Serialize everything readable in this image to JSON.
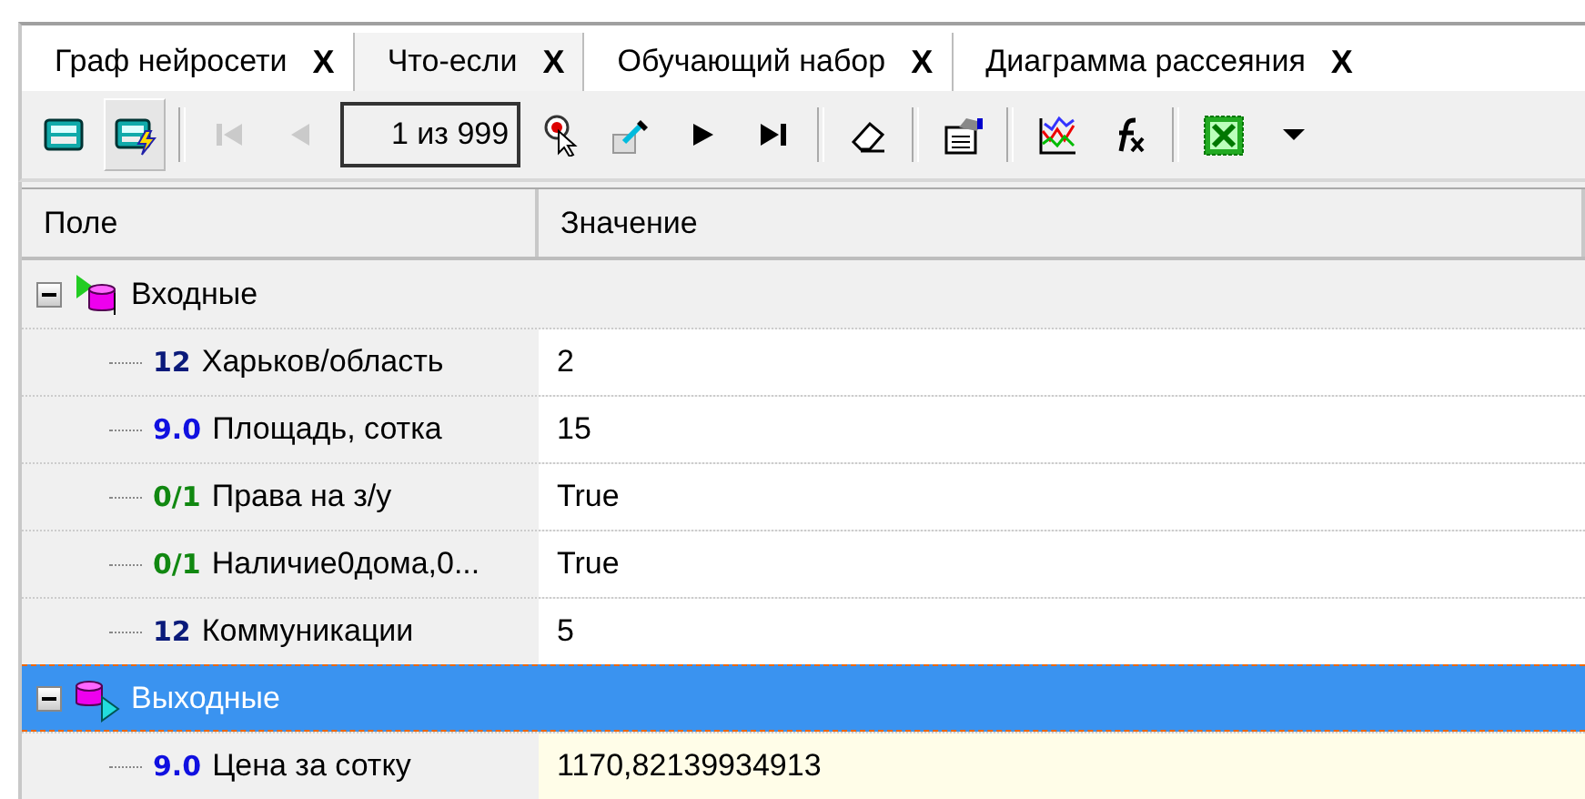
{
  "tabs": [
    {
      "label": "Граф нейросети",
      "close": "X",
      "selected": false
    },
    {
      "label": "Что-если",
      "close": "X",
      "selected": true
    },
    {
      "label": "Обучающий набор",
      "close": "X",
      "selected": false
    },
    {
      "label": "Диаграмма рассеяния",
      "close": "X",
      "selected": false
    }
  ],
  "toolbar": {
    "items": [
      {
        "kind": "button",
        "pressed": false,
        "disabled": false
      },
      {
        "kind": "button",
        "pressed": true,
        "disabled": false
      },
      {
        "kind": "separator"
      },
      {
        "kind": "button",
        "pressed": false,
        "disabled": true
      },
      {
        "kind": "button",
        "pressed": false,
        "disabled": true
      },
      {
        "kind": "record",
        "text": "1 из 999"
      },
      {
        "kind": "button",
        "pressed": false,
        "disabled": false
      },
      {
        "kind": "button",
        "pressed": false,
        "disabled": false
      },
      {
        "kind": "button",
        "pressed": false,
        "disabled": false
      },
      {
        "kind": "button",
        "pressed": false,
        "disabled": false
      },
      {
        "kind": "separator"
      },
      {
        "kind": "button",
        "pressed": false,
        "disabled": false
      },
      {
        "kind": "separator"
      },
      {
        "kind": "button",
        "pressed": false,
        "disabled": false
      },
      {
        "kind": "separator"
      },
      {
        "kind": "button",
        "pressed": false,
        "disabled": false
      },
      {
        "kind": "button",
        "pressed": false,
        "disabled": false
      },
      {
        "kind": "separator"
      },
      {
        "kind": "button",
        "pressed": false,
        "disabled": false
      },
      {
        "kind": "button",
        "pressed": false,
        "disabled": false
      }
    ]
  },
  "grid": {
    "columns": [
      "Поле",
      "Значение"
    ],
    "groups": [
      {
        "label": "Входные",
        "kind": "input",
        "expanded": true,
        "selected": false,
        "children": [
          {
            "type_label": "12",
            "kind": "integer",
            "name": "Харьков/область",
            "value": "2"
          },
          {
            "type_label": "9.0",
            "kind": "real",
            "name": "Площадь, сотка",
            "value": "15"
          },
          {
            "type_label": "0/1",
            "kind": "boolean",
            "name": "Права на з/у",
            "value": "True"
          },
          {
            "type_label": "0/1",
            "kind": "boolean",
            "name": "Наличие0дома,0...",
            "value": "True"
          },
          {
            "type_label": "12",
            "kind": "integer",
            "name": "Коммуникации",
            "value": "5"
          }
        ]
      },
      {
        "label": "Выходные",
        "kind": "output",
        "expanded": true,
        "selected": true,
        "children": [
          {
            "type_label": "9.0",
            "kind": "real",
            "name": "Цена за сотку",
            "value": "1170,82139934913"
          }
        ]
      }
    ]
  }
}
